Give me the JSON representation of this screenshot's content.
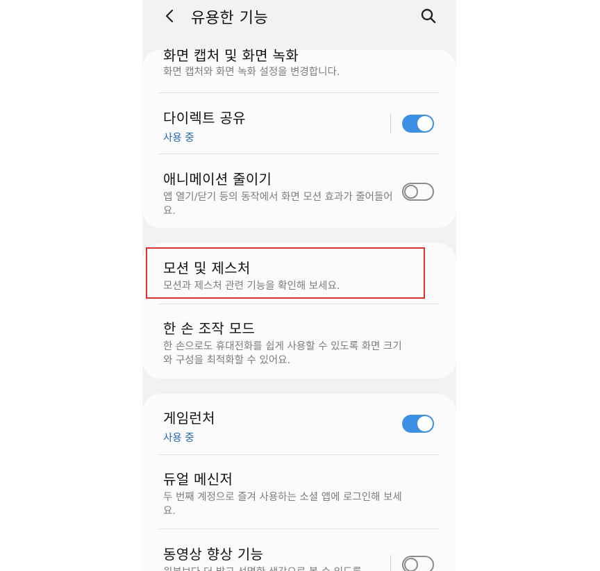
{
  "header": {
    "title": "유용한 기능"
  },
  "card1": {
    "screen_capture": {
      "title": "화면 캡처 및 화면 녹화",
      "desc": "화면 캡처와 화면 녹화 설정을 변경합니다."
    },
    "direct_share": {
      "title": "다이렉트 공유",
      "status": "사용 중",
      "toggle": "on"
    },
    "reduce_animation": {
      "title": "애니메이션 줄이기",
      "desc": "앱 열기/닫기 등의 동작에서 화면 모션 효과가 줄어들어요.",
      "toggle": "off"
    }
  },
  "card2": {
    "motions_gestures": {
      "title": "모션 및 제스처",
      "desc": "모션과 제스처 관련 기능을 확인해 보세요."
    },
    "one_hand_mode": {
      "title": "한 손 조작 모드",
      "desc": "한 손으로도 휴대전화를 쉽게 사용할 수 있도록 화면 크기와 구성을 최적화할 수 있어요."
    }
  },
  "card3": {
    "game_launcher": {
      "title": "게임런처",
      "status": "사용 중",
      "toggle": "on"
    },
    "dual_messenger": {
      "title": "듀얼 메신저",
      "desc": "두 번째 계정으로 즐겨 사용하는 소셜 앱에 로그인해 보세요."
    },
    "video_enhancer": {
      "title": "동영상 향상 기능",
      "desc": "원본보다 더 밝고 선명한 색감으로 볼 수 있도록",
      "toggle": "off"
    }
  },
  "colors": {
    "accent": "#3e8ee3",
    "status_text": "#2367b7",
    "highlight": "#d9342b"
  }
}
